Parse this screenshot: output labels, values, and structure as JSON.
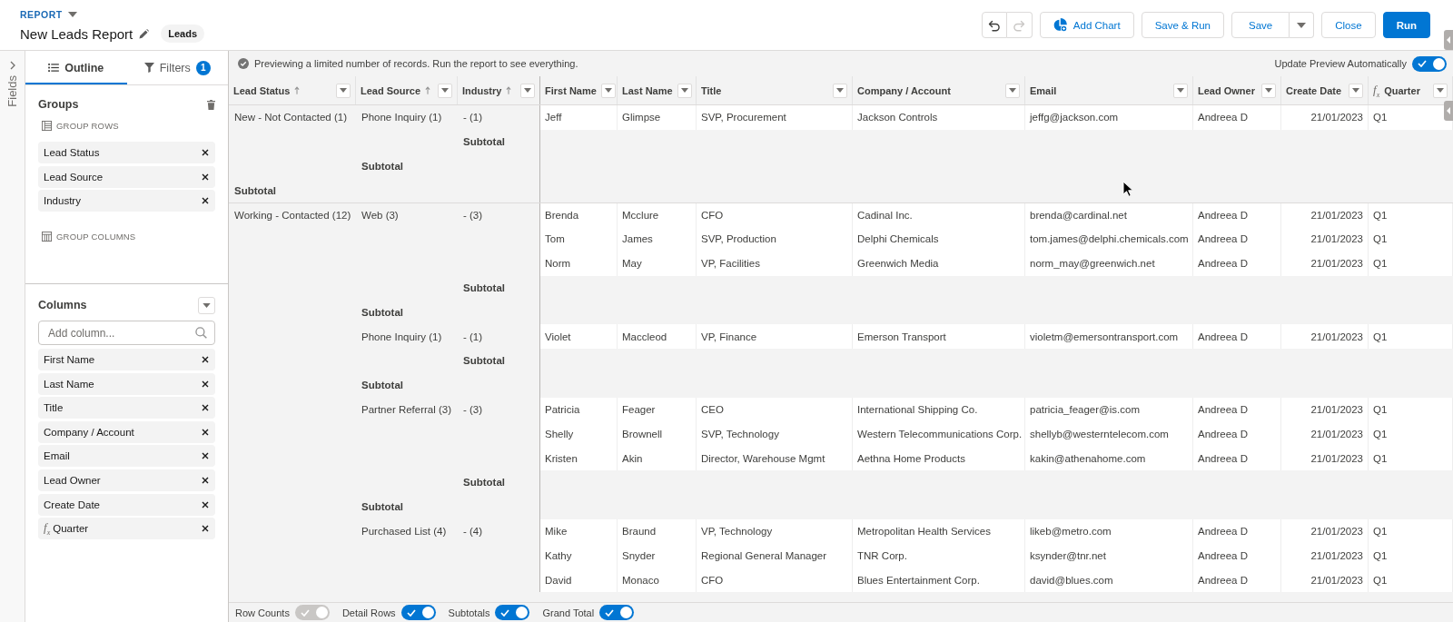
{
  "header": {
    "object_label": "REPORT",
    "title": "New Leads Report",
    "report_type": "Leads",
    "history": [
      {
        "kind": "undo",
        "disabled": false
      },
      {
        "kind": "redo",
        "disabled": true
      }
    ],
    "buttons": [
      {
        "label": "Add Chart",
        "kind": "chart"
      },
      {
        "label": "Save & Run",
        "kind": "neutral"
      },
      {
        "label": "Save",
        "kind": "split"
      },
      {
        "label": "Close",
        "kind": "neutral"
      },
      {
        "label": "Run",
        "kind": "brand"
      }
    ]
  },
  "sidebar": {
    "rail_label": "Fields",
    "tabs": [
      {
        "label": "Outline",
        "kind": "outline",
        "selected": true
      },
      {
        "label": "Filters",
        "kind": "filters",
        "selected": false,
        "badge": "1"
      }
    ],
    "groups": {
      "title": "Groups",
      "rows_label": "GROUP ROWS",
      "rows": [
        "Lead Status",
        "Lead Source",
        "Industry"
      ],
      "columns_label": "GROUP COLUMNS"
    },
    "columns": {
      "title": "Columns",
      "search": {
        "placeholder": "Add column..."
      },
      "items": [
        {
          "label": "First Name",
          "kind": "field"
        },
        {
          "label": "Last Name",
          "kind": "field"
        },
        {
          "label": "Title",
          "kind": "field"
        },
        {
          "label": "Company / Account",
          "kind": "field"
        },
        {
          "label": "Email",
          "kind": "field"
        },
        {
          "label": "Lead Owner",
          "kind": "field"
        },
        {
          "label": "Create Date",
          "kind": "field"
        },
        {
          "label": "Quarter",
          "kind": "formula",
          "symbol": "f$_{x}$"
        }
      ]
    }
  },
  "preview": {
    "notice": "Previewing a limited number of records. Run the report to see everything.",
    "auto_update": {
      "label": "Update Preview Automatically",
      "on": true
    }
  },
  "table": {
    "columns": [
      {
        "label": "Lead Status",
        "kind": "group",
        "sorted": true
      },
      {
        "label": "Lead Source",
        "kind": "group",
        "sorted": true
      },
      {
        "label": "Industry",
        "kind": "group",
        "sorted": true
      },
      {
        "label": "First Name",
        "kind": "text",
        "sorted": false
      },
      {
        "label": "Last Name",
        "kind": "text",
        "sorted": false
      },
      {
        "label": "Title",
        "kind": "text",
        "sorted": false
      },
      {
        "label": "Company / Account",
        "kind": "text",
        "sorted": false
      },
      {
        "label": "Email",
        "kind": "text",
        "sorted": false
      },
      {
        "label": "Lead Owner",
        "kind": "text",
        "sorted": false
      },
      {
        "label": "Create Date",
        "kind": "date",
        "sorted": false
      },
      {
        "label": "Quarter",
        "kind": "formula",
        "symbol": "f$_{x}$",
        "sorted": false
      }
    ],
    "groups": [
      {
        "label": "New - Not Contacted (1)",
        "subtotal": "Subtotal",
        "children": [
          {
            "label": "Phone Inquiry (1)",
            "subtotal": "Subtotal",
            "children": [
              {
                "label": "- (1)",
                "subtotal": "Subtotal",
                "records": [
                  [
                    "Jeff",
                    "Glimpse",
                    "SVP, Procurement",
                    "Jackson Controls",
                    "jeffg@jackson.com",
                    "Andreea D",
                    "21/01/2023",
                    "Q1"
                  ]
                ]
              }
            ]
          }
        ]
      },
      {
        "label": "Working - Contacted (12)",
        "children": [
          {
            "label": "Web (3)",
            "subtotal": "Subtotal",
            "children": [
              {
                "label": "- (3)",
                "subtotal": "Subtotal",
                "records": [
                  [
                    "Brenda",
                    "Mcclure",
                    "CFO",
                    "Cadinal Inc.",
                    "brenda@cardinal.net",
                    "Andreea D",
                    "21/01/2023",
                    "Q1"
                  ],
                  [
                    "Tom",
                    "James",
                    "SVP, Production",
                    "Delphi Chemicals",
                    "tom.james@delphi.chemicals.com",
                    "Andreea D",
                    "21/01/2023",
                    "Q1"
                  ],
                  [
                    "Norm",
                    "May",
                    "VP, Facilities",
                    "Greenwich Media",
                    "norm_may@greenwich.net",
                    "Andreea D",
                    "21/01/2023",
                    "Q1"
                  ]
                ]
              }
            ]
          },
          {
            "label": "Phone Inquiry (1)",
            "subtotal": "Subtotal",
            "children": [
              {
                "label": "- (1)",
                "subtotal": "Subtotal",
                "records": [
                  [
                    "Violet",
                    "Maccleod",
                    "VP, Finance",
                    "Emerson Transport",
                    "violetm@emersontransport.com",
                    "Andreea D",
                    "21/01/2023",
                    "Q1"
                  ]
                ]
              }
            ]
          },
          {
            "label": "Partner Referral (3)",
            "subtotal": "Subtotal",
            "children": [
              {
                "label": "- (3)",
                "subtotal": "Subtotal",
                "records": [
                  [
                    "Patricia",
                    "Feager",
                    "CEO",
                    "International Shipping Co.",
                    "patricia_feager@is.com",
                    "Andreea D",
                    "21/01/2023",
                    "Q1"
                  ],
                  [
                    "Shelly",
                    "Brownell",
                    "SVP, Technology",
                    "Western Telecommunications Corp.",
                    "shellyb@westerntelecom.com",
                    "Andreea D",
                    "21/01/2023",
                    "Q1"
                  ],
                  [
                    "Kristen",
                    "Akin",
                    "Director, Warehouse Mgmt",
                    "Aethna Home Products",
                    "kakin@athenahome.com",
                    "Andreea D",
                    "21/01/2023",
                    "Q1"
                  ]
                ]
              }
            ]
          },
          {
            "label": "Purchased List (4)",
            "children": [
              {
                "label": "- (4)",
                "records": [
                  [
                    "Mike",
                    "Braund",
                    "VP, Technology",
                    "Metropolitan Health Services",
                    "likeb@metro.com",
                    "Andreea D",
                    "21/01/2023",
                    "Q1"
                  ],
                  [
                    "Kathy",
                    "Snyder",
                    "Regional General Manager",
                    "TNR Corp.",
                    "ksynder@tnr.net",
                    "Andreea D",
                    "21/01/2023",
                    "Q1"
                  ],
                  [
                    "David",
                    "Monaco",
                    "CFO",
                    "Blues Entertainment Corp.",
                    "david@blues.com",
                    "Andreea D",
                    "21/01/2023",
                    "Q1"
                  ]
                ]
              }
            ]
          }
        ]
      }
    ]
  },
  "footer": {
    "toggles": [
      {
        "label": "Row Counts",
        "on": true,
        "disabled": true
      },
      {
        "label": "Detail Rows",
        "on": true,
        "disabled": false
      },
      {
        "label": "Subtotals",
        "on": true,
        "disabled": false
      },
      {
        "label": "Grand Total",
        "on": true,
        "disabled": false
      }
    ]
  }
}
